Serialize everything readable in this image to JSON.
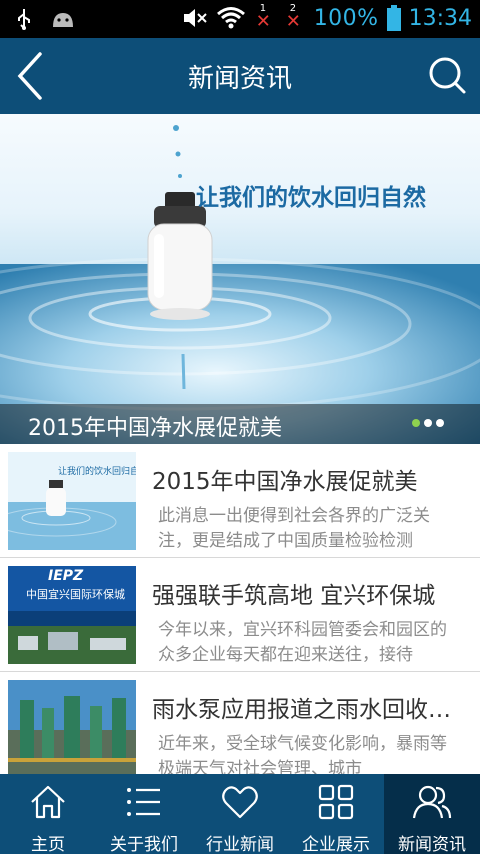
{
  "status_bar": {
    "battery": "100%",
    "time": "13:34",
    "sim1": "1",
    "sim2": "2"
  },
  "header": {
    "title": "新闻资讯",
    "icons": [
      "back-arrow-icon",
      "search-icon"
    ]
  },
  "banner": {
    "slogan": "让我们的饮水回归自然",
    "caption": "2015年中国净水展促就美",
    "slide_count": 3,
    "active_slide": 1
  },
  "news": [
    {
      "title": "2015年中国净水展促就美",
      "description": "此消息一出便得到社会各界的广泛关注，更是结成了中国质量检验检测"
    },
    {
      "title": "强强联手筑高地 宜兴环保城",
      "description": "今年以来，宜兴环科园管委会和园区的众多企业每天都在迎来送往，接待",
      "thumb_badge": "IEPZ",
      "thumb_title": "中国宜兴国际环保城"
    },
    {
      "title": "雨水泵应用报道之雨水回收利用",
      "description": "近年来，受全球气候变化影响，暴雨等极端天气对社会管理、城市"
    }
  ],
  "first_thumb_text": "让我们的饮水回归自然",
  "tabbar": {
    "tabs": [
      {
        "label": "主页",
        "icon": "home-icon"
      },
      {
        "label": "关于我们",
        "icon": "list-icon"
      },
      {
        "label": "行业新闻",
        "icon": "heart-icon"
      },
      {
        "label": "企业展示",
        "icon": "grid-icon"
      },
      {
        "label": "新闻资讯",
        "icon": "people-icon"
      }
    ],
    "active_index": 4
  },
  "colors": {
    "primary": "#0d4e78",
    "active_tab": "#052e4a",
    "status_text": "#33b5e5",
    "dot_active": "#8fd14f"
  }
}
